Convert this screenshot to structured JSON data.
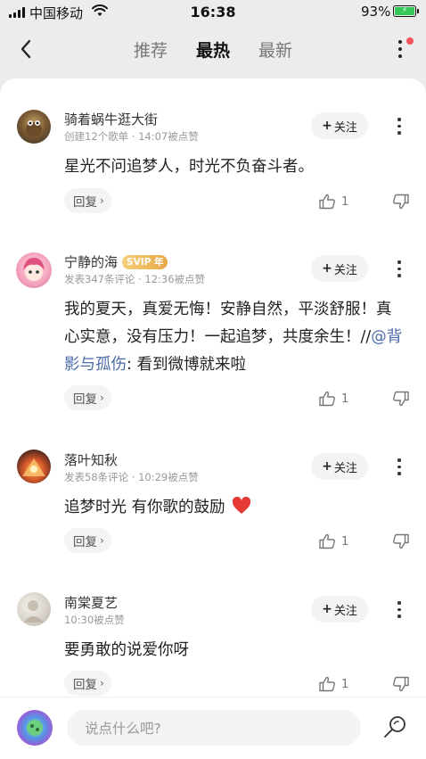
{
  "status_bar": {
    "carrier": "中国移动",
    "time": "16:38",
    "battery_pct": "93%"
  },
  "nav": {
    "tabs": [
      "推荐",
      "最热",
      "最新"
    ],
    "active_tab": "最热"
  },
  "comments": [
    {
      "name": "骑着蜗牛逛大街",
      "meta": "创建12个歌单 · 14:07被点赞",
      "text": "星光不问追梦人，时光不负奋斗者。",
      "likes": "1",
      "follow_label": "关注",
      "reply_label": "回复"
    },
    {
      "name": "宁静的海",
      "badge": "SVIP 年",
      "meta": "发表347条评论 · 12:36被点赞",
      "text": "我的夏天，真爱无悔！安静自然，平淡舒服！真心实意，没有压力！一起追梦，共度余生！//",
      "mention": "@背影与孤伤",
      "text_after": ": 看到微博就来啦",
      "likes": "1",
      "follow_label": "关注",
      "reply_label": "回复"
    },
    {
      "name": "落叶知秋",
      "meta": "发表58条评论 · 10:29被点赞",
      "text": "追梦时光 有你歌的鼓励",
      "likes": "1",
      "follow_label": "关注",
      "reply_label": "回复"
    },
    {
      "name": "南棠夏艺",
      "meta": "10:30被点赞",
      "text": "要勇敢的说爱你呀",
      "likes": "1",
      "follow_label": "关注",
      "reply_label": "回复"
    }
  ],
  "input": {
    "placeholder": "说点什么吧?"
  },
  "colors": {
    "accent_red": "#f2545b",
    "mention_blue": "#4b6aa8",
    "svip_gold": "#e8a948",
    "battery_green": "#34c759"
  }
}
